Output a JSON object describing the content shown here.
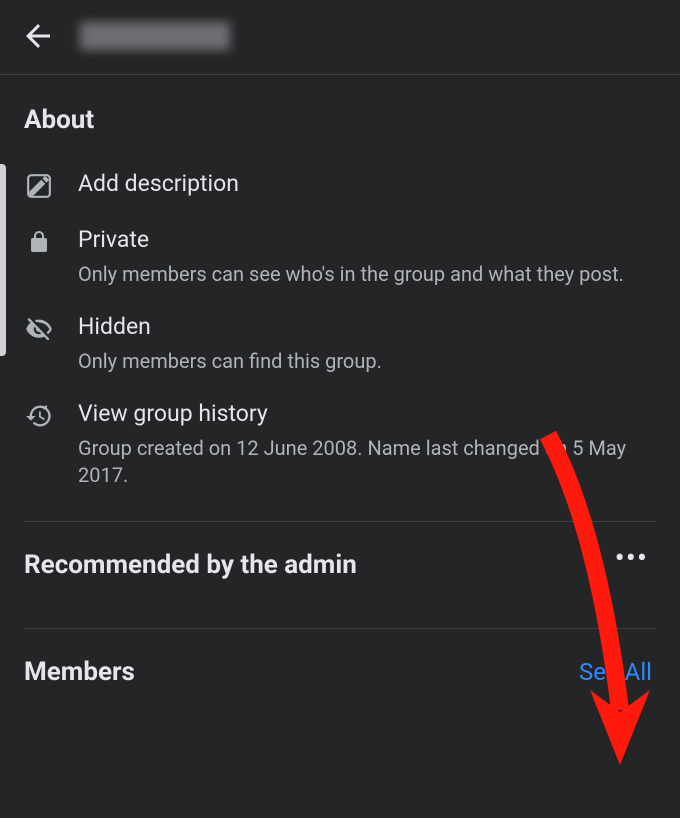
{
  "header": {
    "back_label": "Back"
  },
  "about": {
    "title": "About",
    "items": [
      {
        "label": "Add description",
        "sub": ""
      },
      {
        "label": "Private",
        "sub": "Only members can see who's in the group and what they post."
      },
      {
        "label": "Hidden",
        "sub": "Only members can find this group."
      },
      {
        "label": "View group history",
        "sub": "Group created on 12 June 2008. Name last changed on 5 May 2017."
      }
    ]
  },
  "recommended": {
    "title": "Recommended by the admin"
  },
  "members": {
    "title": "Members",
    "see_all": "See All"
  }
}
